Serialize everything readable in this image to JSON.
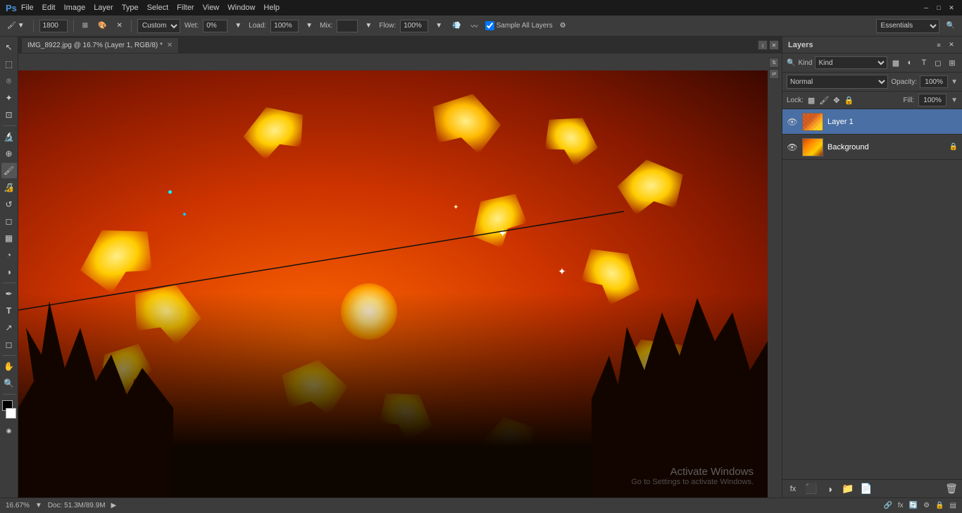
{
  "titlebar": {
    "logo": "Ps",
    "menus": [
      "File",
      "Edit",
      "Image",
      "Layer",
      "Type",
      "Select",
      "Filter",
      "View",
      "Window",
      "Help"
    ],
    "controls": [
      "─",
      "□",
      "✕"
    ]
  },
  "optionsbar": {
    "brush_size": "1800",
    "mode_select": "Custom",
    "wet_label": "Wet:",
    "wet_value": "0%",
    "load_label": "Load:",
    "load_value": "100%",
    "mix_label": "Mix:",
    "mix_value": "",
    "flow_label": "Flow:",
    "flow_value": "100%",
    "sample_all_label": "Sample All Layers",
    "essentials_label": "Essentials"
  },
  "document": {
    "tab_title": "IMG_8922.jpg @ 16.7% (Layer 1, RGB/8) *",
    "zoom": "16.67%",
    "doc_size": "Doc: 51.3M/89.9M"
  },
  "tools": [
    {
      "name": "move",
      "icon": "↖",
      "active": false
    },
    {
      "name": "marquee",
      "icon": "⬚",
      "active": false
    },
    {
      "name": "lasso",
      "icon": "⌾",
      "active": false
    },
    {
      "name": "quick-select",
      "icon": "✦",
      "active": false
    },
    {
      "name": "crop",
      "icon": "⊡",
      "active": false
    },
    {
      "name": "eyedropper",
      "icon": "⬡",
      "active": false
    },
    {
      "name": "healing",
      "icon": "⊕",
      "active": false
    },
    {
      "name": "brush",
      "icon": "⌗",
      "active": false
    },
    {
      "name": "clone-stamp",
      "icon": "✂",
      "active": false
    },
    {
      "name": "history-brush",
      "icon": "↺",
      "active": false
    },
    {
      "name": "eraser",
      "icon": "◻",
      "active": false
    },
    {
      "name": "gradient",
      "icon": "▦",
      "active": false
    },
    {
      "name": "blur",
      "icon": "◔",
      "active": false
    },
    {
      "name": "dodge",
      "icon": "◑",
      "active": false
    },
    {
      "name": "pen",
      "icon": "✒",
      "active": false
    },
    {
      "name": "type",
      "icon": "T",
      "active": false
    },
    {
      "name": "path-selection",
      "icon": "↗",
      "active": false
    },
    {
      "name": "shape",
      "icon": "◻",
      "active": false
    },
    {
      "name": "hand",
      "icon": "✋",
      "active": false
    },
    {
      "name": "zoom",
      "icon": "🔍",
      "active": false
    }
  ],
  "layers_panel": {
    "title": "Layers",
    "filter_label": "Kind",
    "blend_mode": "Normal",
    "opacity_label": "Opacity:",
    "opacity_value": "100%",
    "lock_label": "Lock:",
    "fill_label": "Fill:",
    "fill_value": "100%",
    "layers": [
      {
        "name": "Layer 1",
        "visible": true,
        "selected": true,
        "locked": false,
        "thumb_type": "checker"
      },
      {
        "name": "Background",
        "visible": true,
        "selected": false,
        "locked": true,
        "thumb_type": "photo"
      }
    ],
    "bottom_actions": [
      "fx",
      "⬛",
      "▥",
      "📁",
      "🗑"
    ]
  },
  "watermark": {
    "line1": "Activate Windows",
    "line2": "Go to Settings to activate Windows."
  },
  "statusbar": {
    "zoom": "16.67%",
    "doc_size": "Doc: 51.3M/89.9M"
  }
}
